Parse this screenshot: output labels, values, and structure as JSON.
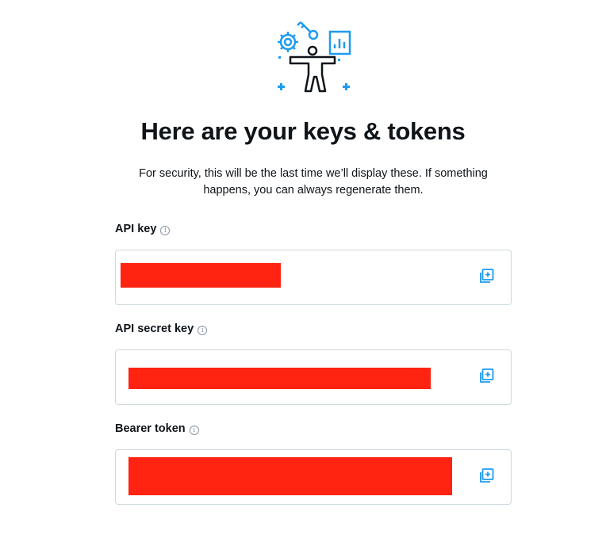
{
  "hero": {
    "icon": "keys-tokens-illustration"
  },
  "title": "Here are your keys & tokens",
  "subtitle": "For security, this will be the last time we’ll display these. If something happens, you can always regenerate them.",
  "fields": [
    {
      "label": "API key",
      "value": "",
      "redacted": true
    },
    {
      "label": "API secret key",
      "value": "",
      "redacted": true
    },
    {
      "label": "Bearer token",
      "value": "",
      "redacted": true
    }
  ],
  "colors": {
    "accent": "#1d9bf0",
    "redaction": "#ff2311",
    "border": "#cfd9de",
    "text": "#0f1419"
  },
  "icons": {
    "info": "info-icon",
    "copy": "copy-icon"
  }
}
